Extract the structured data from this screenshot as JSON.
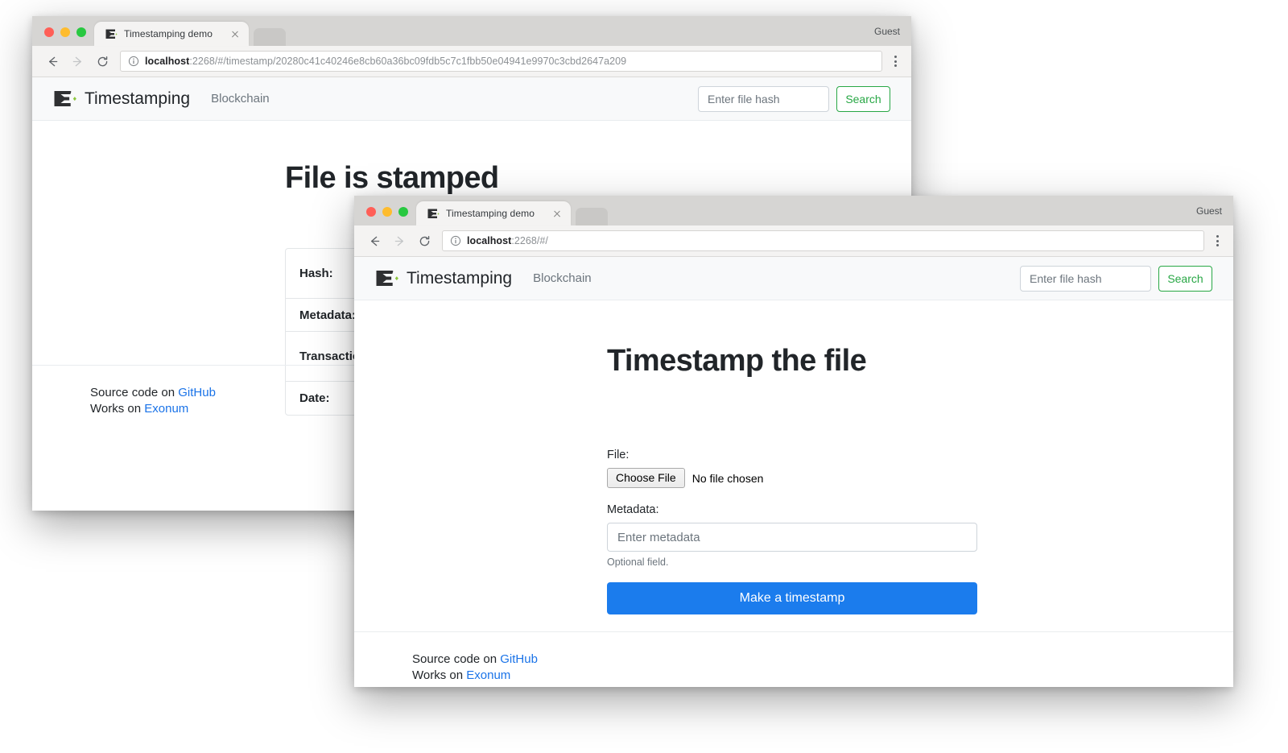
{
  "back_window": {
    "tab": {
      "title": "Timestamping demo",
      "favicon": "exonum-logo-icon",
      "close": "close-icon"
    },
    "profile_label": "Guest",
    "toolbar": {
      "back": "back-arrow-icon",
      "forward": "forward-arrow-icon",
      "reload": "reload-icon",
      "info": "info-circle-icon",
      "menu": "kebab-menu-icon",
      "url_host": "localhost",
      "url_rest": ":2268/#/timestamp/20280c41c40246e8cb60a36bc09fdb5c7c1fbb50e04941e9970c3cbd2647a209"
    },
    "navbar": {
      "brand": "Timestamping",
      "links": [
        "Blockchain"
      ],
      "search_placeholder": "Enter file hash",
      "search_value": "",
      "search_button": "Search"
    },
    "heading": "File is stamped",
    "info_table": [
      {
        "label": "Hash:",
        "value": ""
      },
      {
        "label": "Metadata:",
        "value": ""
      },
      {
        "label": "Transaction:",
        "value": ""
      },
      {
        "label": "Date:",
        "value": ""
      }
    ],
    "footer": {
      "line1_prefix": "Source code on ",
      "line1_link": "GitHub",
      "line2_prefix": "Works on ",
      "line2_link": "Exonum"
    }
  },
  "front_window": {
    "tab": {
      "title": "Timestamping demo",
      "favicon": "exonum-logo-icon",
      "close": "close-icon"
    },
    "profile_label": "Guest",
    "toolbar": {
      "back": "back-arrow-icon",
      "forward": "forward-arrow-icon",
      "reload": "reload-icon",
      "info": "info-circle-icon",
      "menu": "kebab-menu-icon",
      "url_host": "localhost",
      "url_rest": ":2268/#/"
    },
    "navbar": {
      "brand": "Timestamping",
      "links": [
        "Blockchain"
      ],
      "search_placeholder": "Enter file hash",
      "search_value": "",
      "search_button": "Search"
    },
    "heading": "Timestamp the file",
    "form": {
      "file_label": "File:",
      "choose_file_button": "Choose File",
      "file_status": "No file chosen",
      "metadata_label": "Metadata:",
      "metadata_placeholder": "Enter metadata",
      "metadata_value": "",
      "metadata_help": "Optional field.",
      "submit_button": "Make a timestamp"
    },
    "footer": {
      "line1_prefix": "Source code on ",
      "line1_link": "GitHub",
      "line2_prefix": "Works on ",
      "line2_link": "Exonum"
    }
  },
  "colors": {
    "accent_green": "#28a745",
    "primary_blue": "#1b7ced",
    "link_blue": "#1a73e8",
    "logo_dark": "#2f3032",
    "logo_green": "#8cc63f",
    "navbar_bg": "#f8f9fa",
    "chrome_tabstrip": "#d6d5d3",
    "chrome_toolbar": "#f4f3f2"
  }
}
